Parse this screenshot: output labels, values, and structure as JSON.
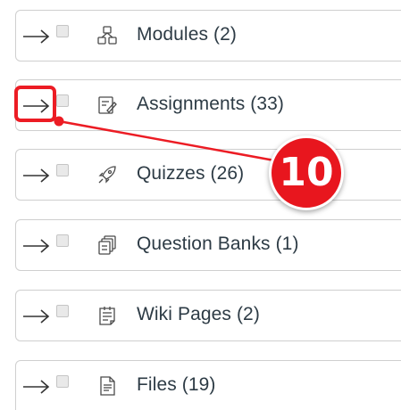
{
  "items": [
    {
      "label": "Modules (2)",
      "icon": "modules-icon"
    },
    {
      "label": "Assignments (33)",
      "icon": "assignments-icon"
    },
    {
      "label": "Quizzes (26)",
      "icon": "quizzes-icon"
    },
    {
      "label": "Question Banks (1)",
      "icon": "question-banks-icon"
    },
    {
      "label": "Wiki Pages (2)",
      "icon": "wiki-pages-icon"
    },
    {
      "label": "Files (19)",
      "icon": "files-icon"
    }
  ],
  "annotation": {
    "step_number": "10",
    "highlight_color": "#ec1c24"
  },
  "colors": {
    "text": "#2d3b45",
    "border": "#cfcfcf",
    "icon": "#4a4a4a"
  }
}
